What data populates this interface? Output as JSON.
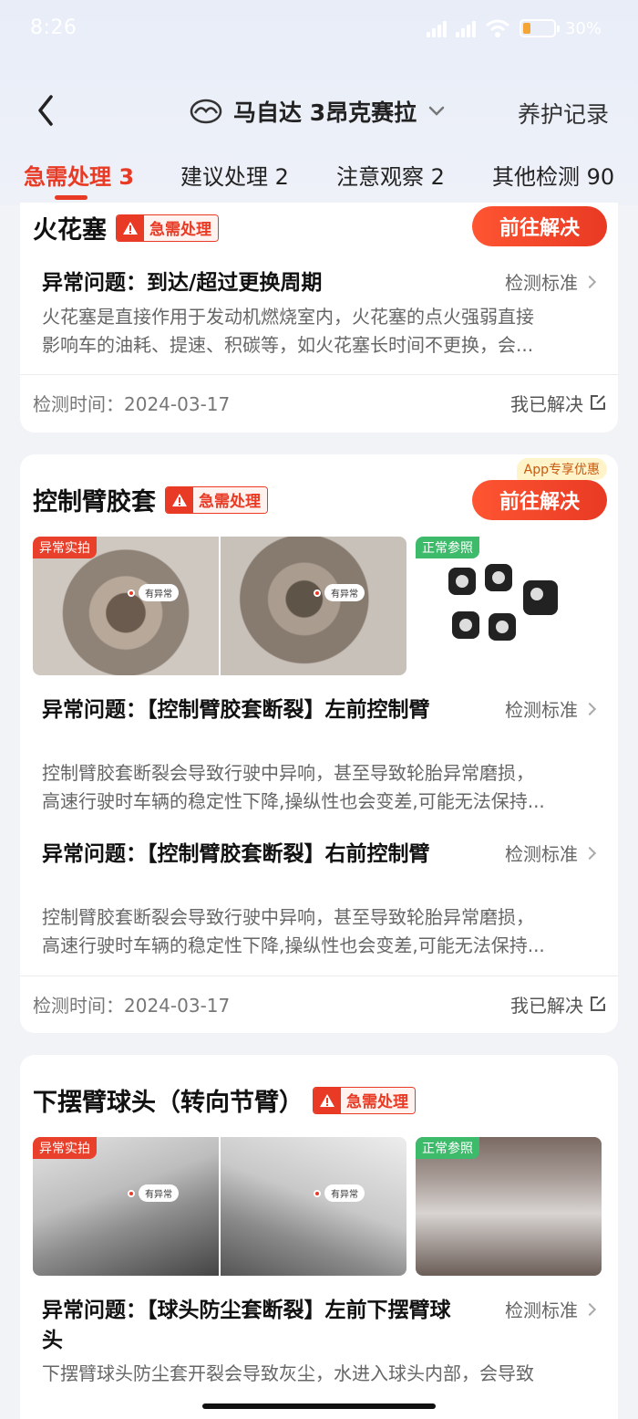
{
  "status_bar": {
    "time": "8:26",
    "battery": "30%"
  },
  "nav": {
    "car_name": "马自达 3昂克赛拉",
    "records_label": "养护记录"
  },
  "tabs": [
    {
      "label": "急需处理 3",
      "active": true
    },
    {
      "label": "建议处理 2",
      "active": false
    },
    {
      "label": "注意观察 2",
      "active": false
    },
    {
      "label": "其他检测 90",
      "active": false
    }
  ],
  "colors": {
    "accent": "#e83a24",
    "normal_tag": "#3dbb6b",
    "promo_bg": "#fff3c9"
  },
  "cards": [
    {
      "title": "火花塞",
      "badge": "急需处理",
      "action_label": "前往解决",
      "issues": [
        {
          "title": "异常问题：到达/超过更换周期",
          "standard_label": "检测标准",
          "desc_line1": "火花塞是直接作用于发动机燃烧室内，火花塞的点火强弱直接",
          "desc_line2": "影响车的油耗、提速、积碳等，如火花塞长时间不更换，会..."
        }
      ],
      "footer": {
        "time": "检测时间：2024-03-17",
        "solved_label": "我已解决"
      }
    },
    {
      "title": "控制臂胶套",
      "badge": "急需处理",
      "action_label": "前往解决",
      "promo": "App专享优惠",
      "photos": {
        "abnormal_tag": "异常实拍",
        "normal_tag": "正常参照",
        "pin_label": "有异常"
      },
      "issues": [
        {
          "title": "异常问题：【控制臂胶套断裂】左前控制臂",
          "standard_label": "检测标准",
          "desc_line1": "控制臂胶套断裂会导致行驶中异响，甚至导致轮胎异常磨损，",
          "desc_line2": "高速行驶时车辆的稳定性下降,操纵性也会变差,可能无法保持..."
        },
        {
          "title": "异常问题：【控制臂胶套断裂】右前控制臂",
          "standard_label": "检测标准",
          "desc_line1": "控制臂胶套断裂会导致行驶中异响，甚至导致轮胎异常磨损，",
          "desc_line2": "高速行驶时车辆的稳定性下降,操纵性也会变差,可能无法保持..."
        }
      ],
      "footer": {
        "time": "检测时间：2024-03-17",
        "solved_label": "我已解决"
      }
    },
    {
      "title": "下摆臂球头（转向节臂）",
      "badge": "急需处理",
      "photos": {
        "abnormal_tag": "异常实拍",
        "normal_tag": "正常参照",
        "pin_label": "有异常"
      },
      "issues": [
        {
          "title": "异常问题：【球头防尘套断裂】左前下摆臂球头",
          "standard_label": "检测标准",
          "desc_line1": "下摆臂球头防尘套开裂会导致灰尘，水进入球头内部，会导致"
        }
      ]
    }
  ]
}
